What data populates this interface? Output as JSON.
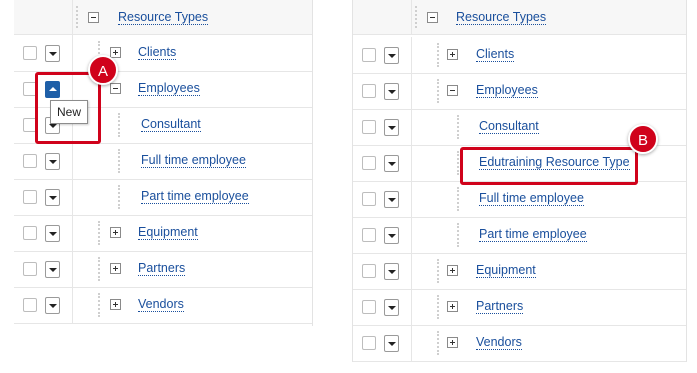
{
  "colors": {
    "link": "#1a4f9c",
    "callout_red": "#d0021b",
    "active_button": "#1e5fa8"
  },
  "left_panel": {
    "header": "Resource Types",
    "items": [
      {
        "label": "Clients",
        "expander": "plus"
      },
      {
        "label": "Employees",
        "expander": "minus"
      },
      {
        "label": "Consultant",
        "expander": "none"
      },
      {
        "label": "Full time employee",
        "expander": "none"
      },
      {
        "label": "Part time employee",
        "expander": "none"
      },
      {
        "label": "Equipment",
        "expander": "plus"
      },
      {
        "label": "Partners",
        "expander": "plus"
      },
      {
        "label": "Vendors",
        "expander": "plus"
      }
    ],
    "tooltip": "New",
    "callout": "A"
  },
  "right_panel": {
    "header": "Resource Types",
    "items": [
      {
        "label": "Clients",
        "expander": "plus"
      },
      {
        "label": "Employees",
        "expander": "minus"
      },
      {
        "label": "Consultant",
        "expander": "none"
      },
      {
        "label": "Edutraining Resource Type",
        "expander": "none"
      },
      {
        "label": "Full time employee",
        "expander": "none"
      },
      {
        "label": "Part time employee",
        "expander": "none"
      },
      {
        "label": "Equipment",
        "expander": "plus"
      },
      {
        "label": "Partners",
        "expander": "plus"
      },
      {
        "label": "Vendors",
        "expander": "plus"
      }
    ],
    "callout": "B"
  }
}
